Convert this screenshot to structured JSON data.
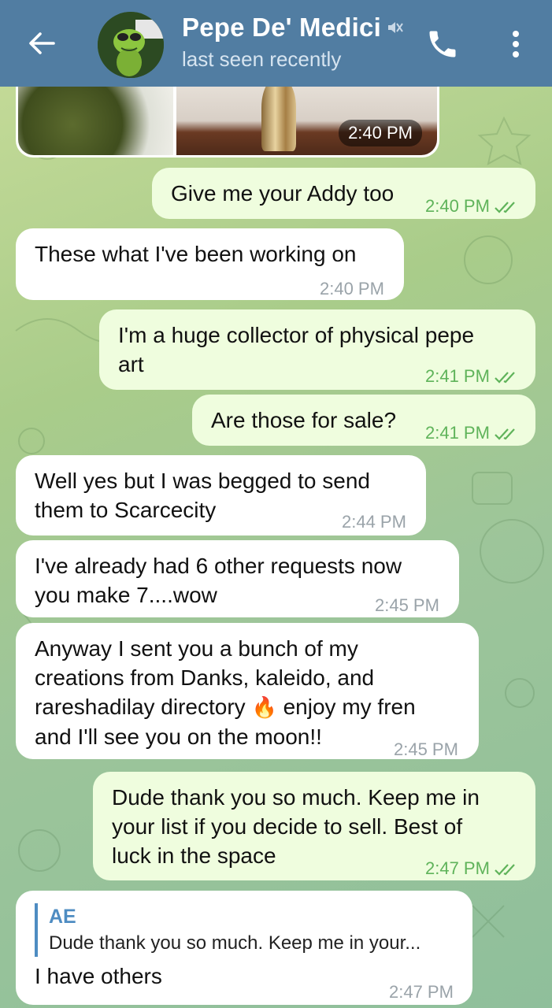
{
  "header": {
    "contact_name": "Pepe De' Medici",
    "status": "last seen recently",
    "icons": [
      "back-arrow-icon",
      "muted-icon",
      "phone-icon",
      "more-vertical-icon"
    ]
  },
  "media": {
    "time": "2:40 PM"
  },
  "messages": [
    {
      "dir": "out",
      "text": "Give me your Addy too",
      "time": "2:40 PM",
      "read": true
    },
    {
      "dir": "in",
      "text": "These what I've been working on",
      "time": "2:40 PM"
    },
    {
      "dir": "out",
      "text": "I'm a huge collector of physical pepe\nart",
      "time": "2:41 PM",
      "read": true
    },
    {
      "dir": "out",
      "text": "Are those for sale?",
      "time": "2:41 PM",
      "read": true
    },
    {
      "dir": "in",
      "text": "Well yes but I was begged to send\nthem to Scarcecity",
      "time": "2:44 PM"
    },
    {
      "dir": "in",
      "text": "I've already had 6 other requests now\nyou make 7....wow",
      "time": "2:45 PM"
    },
    {
      "dir": "in",
      "text_line1": "Anyway I sent you a bunch of my",
      "text_line2": "creations from Danks, kaleido, and",
      "text_line3a": "rareshadilay directory ",
      "emoji": "🔥",
      "text_line3b": " enjoy my fren",
      "text_line4": "and I'll see you on the moon!!",
      "time": "2:45 PM"
    },
    {
      "dir": "out",
      "text": "Dude thank you so much. Keep me in\nyour list if you decide to sell. Best of\nluck in the space",
      "time": "2:47 PM",
      "read": true
    },
    {
      "dir": "in",
      "reply_name": "AE",
      "reply_text": "Dude thank you so much. Keep me in your...",
      "text": "I have others",
      "time": "2:47 PM"
    }
  ],
  "colors": {
    "header": "#517da2",
    "outgoing_bubble": "#effdde",
    "incoming_bubble": "#ffffff",
    "outgoing_time": "#5fb35a",
    "reply_accent": "#4e8cc2"
  }
}
